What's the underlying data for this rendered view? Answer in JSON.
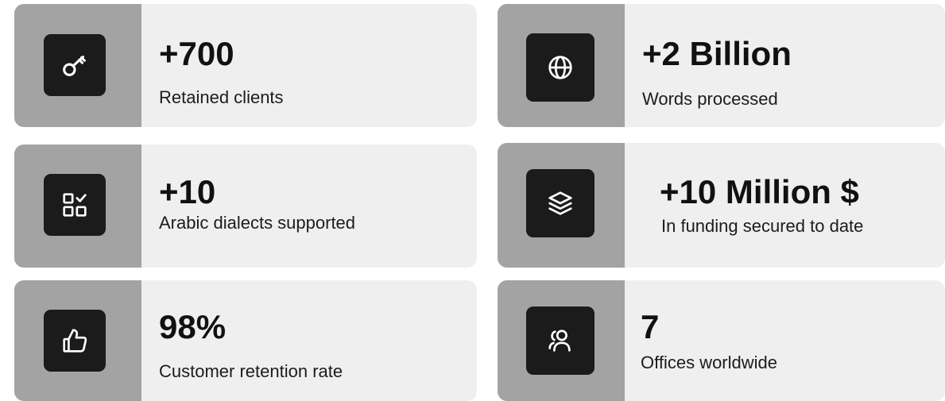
{
  "stats": [
    {
      "value": "+700",
      "label": "Retained clients",
      "icon": "key-icon"
    },
    {
      "value": "+2 Billion",
      "label": "Words processed",
      "icon": "globe-icon"
    },
    {
      "value": "+10",
      "label": "Arabic dialects supported",
      "icon": "grid-check-icon"
    },
    {
      "value": "+10 Million $",
      "label": "In funding secured to date",
      "icon": "layers-icon"
    },
    {
      "value": "98%",
      "label": "Customer retention rate",
      "icon": "thumbs-up-icon"
    },
    {
      "value": "7",
      "label": "Offices worldwide",
      "icon": "users-icon"
    }
  ],
  "colors": {
    "card_bg": "#efefef",
    "side_bg": "#a3a3a3",
    "icon_bg": "#1b1b1b",
    "icon_fg": "#ffffff"
  }
}
